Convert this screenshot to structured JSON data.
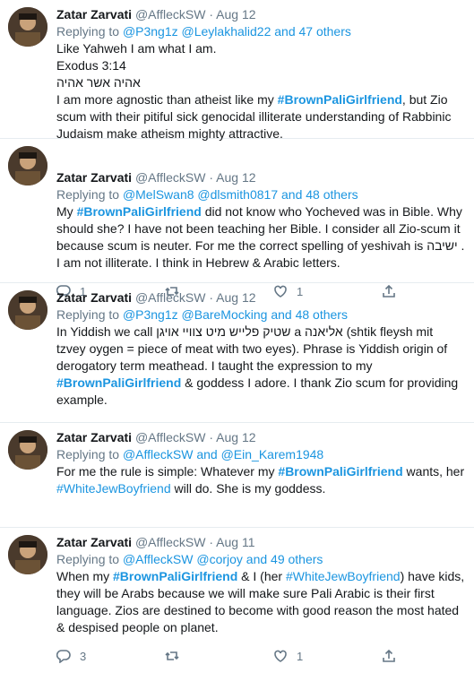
{
  "user": {
    "name": "Zatar Zarvati",
    "handle": "@AffleckSW",
    "sep": "·"
  },
  "tweets": [
    {
      "date": "Aug 12",
      "reply_prefix": "Replying to",
      "reply_to": "@P3ng1z @Leylakhalid22 and 47 others",
      "lines": [
        "Like Yahweh I am what I am.",
        "Exodus 3:14",
        "אהיה אשר אהיה"
      ],
      "p1": "I am more agnostic than atheist like my ",
      "tag1": "#BrownPaliGirlfriend",
      "p2": ", but Zio scum with their pitiful sick genocidal illiterate understanding of Rabbinic Judaism make atheism mighty attractive."
    },
    {
      "date": "Aug 12",
      "reply_prefix": "Replying to",
      "reply_to": "@MelSwan8 @dlsmith0817 and 48 others",
      "p0": "My ",
      "tag1": "#BrownPaliGirlfriend",
      "p1": " did not know who Yocheved was in Bible. Why should she? I have not been teaching her Bible. I consider all Zio-scum it because scum is neuter. For me the correct spelling of yeshivah is ישיבה . I am not illiterate. I think in Hebrew & Arabic letters.",
      "counts": {
        "reply": "1",
        "retweet": "",
        "like": "1"
      }
    },
    {
      "date": "Aug 12",
      "reply_prefix": "Replying to",
      "reply_to": "@P3ng1z @BareMocking and 48 others",
      "p0": "In Yiddish we call שטיק פלייש מיט צוויי אויגן a אליאנה (shtik fleysh mit tzvey oygen = piece of meat with two eyes). Phrase is Yiddish origin of derogatory term meathead. I taught the expression to my ",
      "tag1": "#BrownPaliGirlfriend",
      "p1": " & goddess I adore. I thank Zio scum for providing example."
    },
    {
      "date": "Aug 12",
      "reply_prefix": "Replying to",
      "reply_to": "@AffleckSW and @Ein_Karem1948",
      "p0": "For me the rule is simple: Whatever my ",
      "tag1": "#BrownPaliGirlfriend",
      "p1": " wants, her ",
      "tag2": "#WhiteJewBoyfriend",
      "p2": " will do. She is my goddess."
    },
    {
      "date": "Aug 11",
      "reply_prefix": "Replying to",
      "reply_to": "@AffleckSW @corjoy and 49 others",
      "p0": "When my ",
      "tag1": "#BrownPaliGirlfriend",
      "p1": " & I (her ",
      "tag2": "#WhiteJewBoyfriend",
      "p2": ") have kids, they will be Arabs because we will make sure Pali Arabic is their first language. Zios are destined to become with good reason the most hated & despised people on planet.",
      "counts": {
        "reply": "3",
        "retweet": "",
        "like": "1"
      }
    }
  ]
}
